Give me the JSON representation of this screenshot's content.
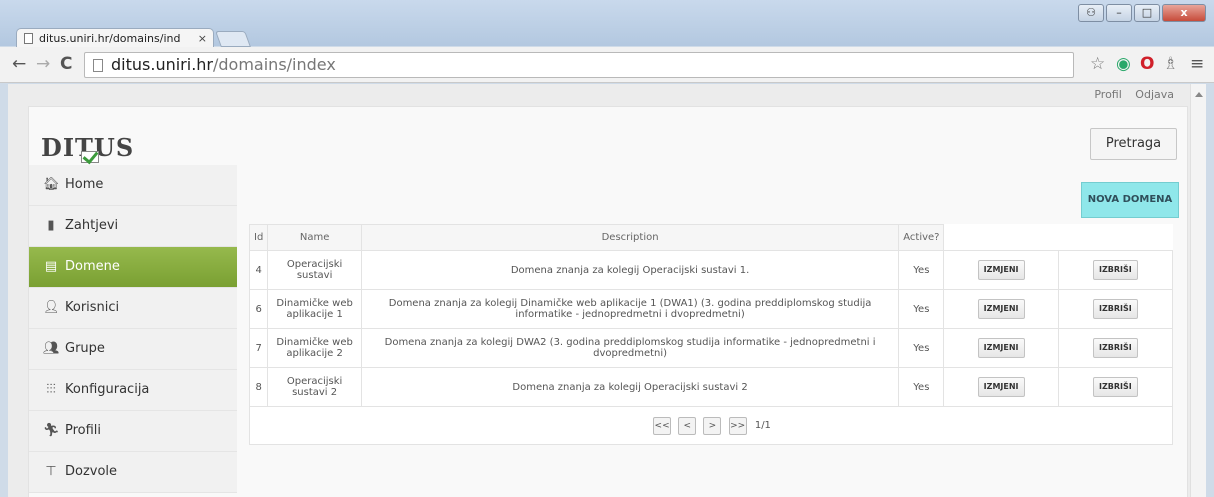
{
  "browser": {
    "tab_title": "ditus.uniri.hr/domains/ind",
    "tab_close": "×",
    "url_host": "ditus.uniri.hr",
    "url_path": "/domains/index",
    "back": "←",
    "forward": "→",
    "reload": "C",
    "star": "☆",
    "menu": "≡",
    "window_minimize": "–",
    "window_maximize": "□",
    "window_close": "x",
    "window_extra": "⚇"
  },
  "top_links": {
    "profil": "Profil",
    "odjava": "Odjava"
  },
  "logo": {
    "text": "DITUS"
  },
  "search_button": "Pretraga",
  "new_button": "NOVA DOMENA",
  "sidebar": {
    "items": [
      {
        "label": "Home",
        "icon": "home-icon",
        "glyph": "🏠︎"
      },
      {
        "label": "Zahtjevi",
        "icon": "clipboard-icon",
        "glyph": "▮"
      },
      {
        "label": "Domene",
        "icon": "server-icon",
        "glyph": "▤"
      },
      {
        "label": "Korisnici",
        "icon": "user-icon",
        "glyph": "👤︎"
      },
      {
        "label": "Grupe",
        "icon": "group-icon",
        "glyph": "👥︎"
      },
      {
        "label": "Konfiguracija",
        "icon": "sliders-icon",
        "glyph": "⫶⫶⫶"
      },
      {
        "label": "Profili",
        "icon": "person-icon",
        "glyph": "🏃︎"
      },
      {
        "label": "Dozvole",
        "icon": "key-icon",
        "glyph": "⊤"
      }
    ],
    "active_index": 2
  },
  "table": {
    "headers": {
      "id": "Id",
      "name": "Name",
      "description": "Description",
      "active": "Active?"
    },
    "rows": [
      {
        "id": "4",
        "name": "Operacijski sustavi",
        "description": "Domena znanja za kolegij Operacijski sustavi 1.",
        "active": "Yes",
        "edit": "IZMJENI",
        "delete": "IZBRIŠI"
      },
      {
        "id": "6",
        "name": "Dinamičke web aplikacije 1",
        "description": "Domena znanja za kolegij Dinamičke web aplikacije 1 (DWA1) (3. godina preddiplomskog studija informatike - jednopredmetni i dvopredmetni)",
        "active": "Yes",
        "edit": "IZMJENI",
        "delete": "IZBRIŠI"
      },
      {
        "id": "7",
        "name": "Dinamičke web aplikacije 2",
        "description": "Domena znanja za kolegij DWA2 (3. godina preddiplomskog studija informatike - jednopredmetni i dvopredmetni)",
        "active": "Yes",
        "edit": "IZMJENI",
        "delete": "IZBRIŠI"
      },
      {
        "id": "8",
        "name": "Operacijski sustavi 2",
        "description": "Domena znanja za kolegij Operacijski sustavi 2",
        "active": "Yes",
        "edit": "IZMJENI",
        "delete": "IZBRIŠI"
      }
    ]
  },
  "pager": {
    "first": "<<",
    "prev": "<",
    "next": ">",
    "last": ">>",
    "info": "1/1"
  },
  "colors": {
    "active_nav": "#8db047",
    "new_button": "#8fe7ea"
  }
}
